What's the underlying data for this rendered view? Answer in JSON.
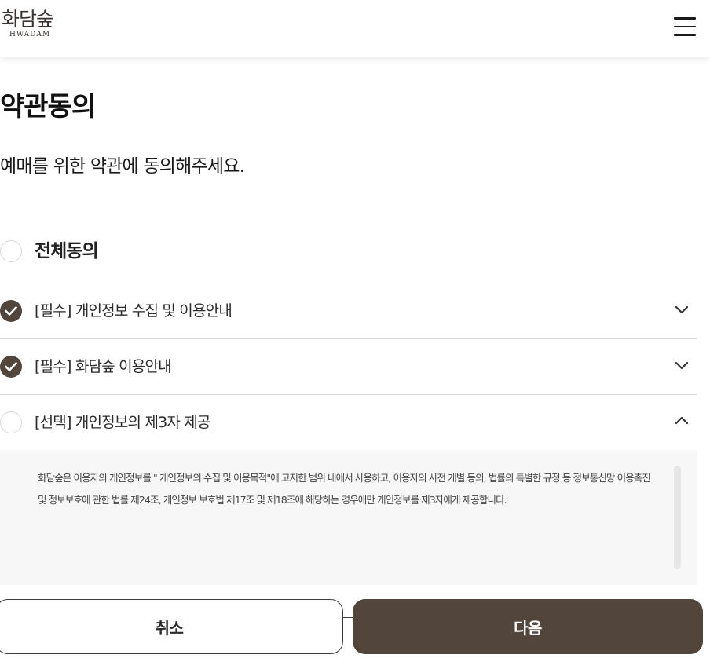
{
  "header": {
    "logo_text": "화담숲",
    "logo_sub": "HWADAM",
    "menu_icon": "hamburger-menu-icon"
  },
  "page": {
    "title": "약관동의",
    "subtitle": "예매를 위한 약관에 동의해주세요."
  },
  "agree_all": {
    "label": "전체동의",
    "checked": false
  },
  "items": [
    {
      "label": "[필수] 개인정보 수집 및 이용안내",
      "checked": true,
      "expanded": false
    },
    {
      "label": "[필수] 화담숲 이용안내",
      "checked": true,
      "expanded": false
    },
    {
      "label": "[선택] 개인정보의 제3자 제공",
      "checked": false,
      "expanded": true
    }
  ],
  "terms_detail": {
    "text": "화담숲은 이용자의 개인정보를 \" 개인정보의 수집 및 이용목적\"에 고지한 범위 내에서 사용하고, 이용자의 사전 개별 동의, 법률의 특별한 규정 등 정보통신망 이용촉진 및 정보보호에 관한 법률 제24조, 개인정보 보호법 제17조 및 제18조에 해당하는 경우에만 개인정보를 제3자에게 제공합니다."
  },
  "buttons": {
    "cancel_label": "취소",
    "next_label": "다음"
  },
  "colors": {
    "brand": "#52453c",
    "divider": "#dcdcdc",
    "terms_bg": "#f7f7f7"
  }
}
